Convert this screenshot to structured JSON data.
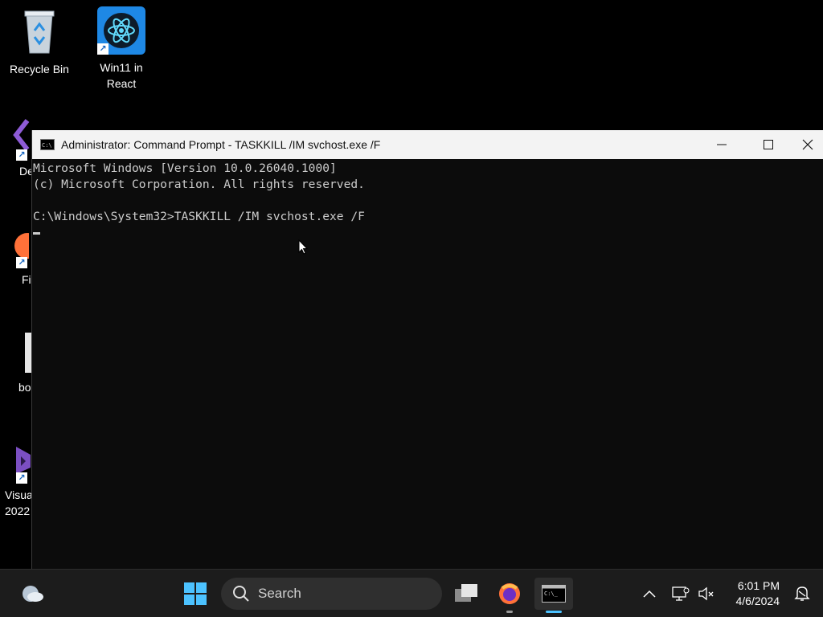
{
  "desktop": {
    "icons": [
      {
        "label": "Recycle Bin"
      },
      {
        "label": "Win11 in\nReact"
      }
    ],
    "edge_labels": [
      "De",
      "Fi",
      "bo",
      "Visua\n2022"
    ]
  },
  "window": {
    "title": "Administrator: Command Prompt - TASKKILL  /IM svchost.exe /F",
    "icon_text": "C:\\",
    "console_lines": [
      "Microsoft Windows [Version 10.0.26040.1000]",
      "(c) Microsoft Corporation. All rights reserved.",
      "",
      "C:\\Windows\\System32>TASKKILL /IM svchost.exe /F"
    ]
  },
  "taskbar": {
    "search_placeholder": "Search",
    "time": "6:01 PM",
    "date": "4/6/2024"
  },
  "colors": {
    "console_bg": "#0c0c0c",
    "console_text": "#cccccc",
    "taskbar_bg": "#1c1c1c",
    "accent": "#4cc2ff"
  }
}
